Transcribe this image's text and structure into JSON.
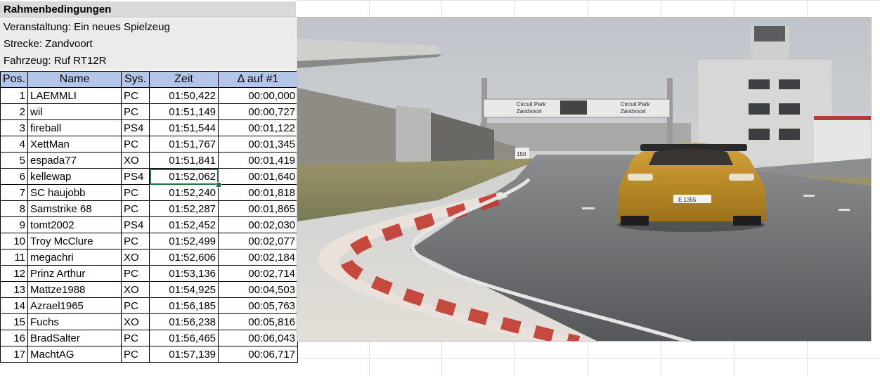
{
  "header": {
    "title": "Rahmenbedingungen",
    "event": "Veranstaltung: Ein neues Spielzeug",
    "track": "Strecke: Zandvoort",
    "car": "Fahrzeug: Ruf RT12R"
  },
  "table": {
    "columns": [
      "Pos.",
      "Name",
      "Sys.",
      "Zeit",
      "Δ auf #1"
    ],
    "rows": [
      {
        "pos": "1",
        "name": "LAEMMLI",
        "sys": "PC",
        "zeit": "01:50,422",
        "delta": "00:00,000"
      },
      {
        "pos": "2",
        "name": "wil",
        "sys": "PC",
        "zeit": "01:51,149",
        "delta": "00:00,727"
      },
      {
        "pos": "3",
        "name": "fireball",
        "sys": "PS4",
        "zeit": "01:51,544",
        "delta": "00:01,122"
      },
      {
        "pos": "4",
        "name": "XettMan",
        "sys": "PC",
        "zeit": "01:51,767",
        "delta": "00:01,345"
      },
      {
        "pos": "5",
        "name": "espada77",
        "sys": "XO",
        "zeit": "01:51,841",
        "delta": "00:01,419"
      },
      {
        "pos": "6",
        "name": "kellewap",
        "sys": "PS4",
        "zeit": "01:52,062",
        "delta": "00:01,640"
      },
      {
        "pos": "7",
        "name": "SC haujobb",
        "sys": "PC",
        "zeit": "01:52,240",
        "delta": "00:01,818"
      },
      {
        "pos": "8",
        "name": "Samstrike 68",
        "sys": "PC",
        "zeit": "01:52,287",
        "delta": "00:01,865"
      },
      {
        "pos": "9",
        "name": "tomt2002",
        "sys": "PS4",
        "zeit": "01:52,452",
        "delta": "00:02,030"
      },
      {
        "pos": "10",
        "name": "Troy McClure",
        "sys": "PC",
        "zeit": "01:52,499",
        "delta": "00:02,077"
      },
      {
        "pos": "11",
        "name": "megachri",
        "sys": "XO",
        "zeit": "01:52,606",
        "delta": "00:02,184"
      },
      {
        "pos": "12",
        "name": "Prinz Arthur",
        "sys": "PC",
        "zeit": "01:53,136",
        "delta": "00:02,714"
      },
      {
        "pos": "13",
        "name": "Mattze1988",
        "sys": "XO",
        "zeit": "01:54,925",
        "delta": "00:04,503"
      },
      {
        "pos": "14",
        "name": "Azrael1965",
        "sys": "PC",
        "zeit": "01:56,185",
        "delta": "00:05,763"
      },
      {
        "pos": "15",
        "name": "Fuchs",
        "sys": "XO",
        "zeit": "01:56,238",
        "delta": "00:05,816"
      },
      {
        "pos": "16",
        "name": "BradSalter",
        "sys": "PC",
        "zeit": "01:56,465",
        "delta": "00:06,043"
      },
      {
        "pos": "17",
        "name": "MachtAG",
        "sys": "PC",
        "zeit": "01:57,139",
        "delta": "00:06,717"
      }
    ]
  },
  "photo": {
    "banner_left_1": "Circuit Park",
    "banner_left_2": "Zandvoort",
    "banner_right_1": "Circuit Park",
    "banner_right_2": "Zandvoort",
    "distance_board": "150",
    "plate": "E 1355"
  },
  "colors": {
    "header_fill": "#b4c6e7",
    "selection": "#217346",
    "car": "#c8961e"
  }
}
